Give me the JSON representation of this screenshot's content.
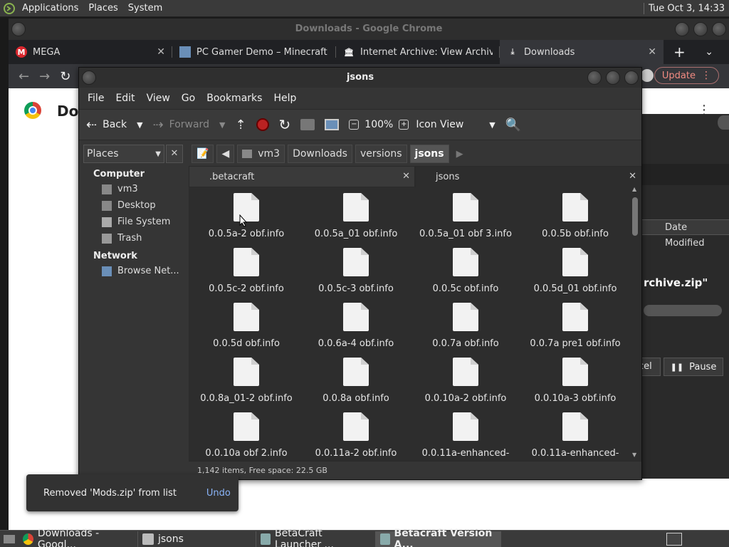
{
  "top_panel": {
    "menus": [
      "Applications",
      "Places",
      "System"
    ],
    "clock": "Tue Oct  3, 14:33"
  },
  "chrome": {
    "window_title": "Downloads - Google Chrome",
    "tabs": [
      {
        "label": "MEGA",
        "icon": "mega-icon"
      },
      {
        "label": "PC Gamer Demo – Minecraft",
        "icon": "minecraft-block-icon"
      },
      {
        "label": "Internet Archive: View Archive",
        "icon": "archive-icon"
      },
      {
        "label": "Downloads",
        "icon": "download-icon"
      }
    ],
    "update_label": "Update",
    "page_title": "Dow",
    "date_modified_header": "Date Modified",
    "download_file": "rchive.zip\"",
    "cancel_fragment": "cel",
    "pause_label": "Pause",
    "toast_message": "Removed 'Mods.zip' from list",
    "toast_action": "Undo"
  },
  "file_manager": {
    "title": "jsons",
    "menubar": [
      "File",
      "Edit",
      "View",
      "Go",
      "Bookmarks",
      "Help"
    ],
    "toolbar": {
      "back": "Back",
      "forward": "Forward",
      "zoom": "100%",
      "view_mode": "Icon View"
    },
    "sidebar": {
      "selector": "Places",
      "sections": [
        {
          "heading": "Computer",
          "items": [
            "vm3",
            "Desktop",
            "File System",
            "Trash"
          ]
        },
        {
          "heading": "Network",
          "items": [
            "Browse Net..."
          ]
        }
      ]
    },
    "path": [
      "vm3",
      "Downloads",
      "versions",
      "jsons"
    ],
    "tabs": [
      ".betacraft",
      "jsons"
    ],
    "files": [
      "0.0.5a-2 obf.info",
      "0.0.5a_01 obf.info",
      "0.0.5a_01 obf 3.info",
      "0.0.5b obf.info",
      "0.0.5c-2 obf.info",
      "0.0.5c-3 obf.info",
      "0.0.5c obf.info",
      "0.0.5d_01 obf.info",
      "0.0.5d obf.info",
      "0.0.6a-4 obf.info",
      "0.0.7a obf.info",
      "0.0.7a pre1 obf.info",
      "0.0.8a_01-2 obf.info",
      "0.0.8a obf.info",
      "0.0.10a-2 obf.info",
      "0.0.10a-3 obf.info",
      "0.0.10a obf 2.info",
      "0.0.11a-2 obf.info",
      "0.0.11a-enhanced-",
      "0.0.11a-enhanced-"
    ],
    "status": "1,142 items, Free space: 22.5 GB"
  },
  "taskbar": [
    {
      "label": "Downloads - Googl...",
      "icon": "chrome-icon",
      "active": false
    },
    {
      "label": "jsons",
      "icon": "folder-icon",
      "active": false
    },
    {
      "label": "BetaCraft Launcher ...",
      "icon": "app-icon",
      "active": false
    },
    {
      "label": "Betacraft Version A...",
      "icon": "app-icon",
      "active": true
    }
  ]
}
